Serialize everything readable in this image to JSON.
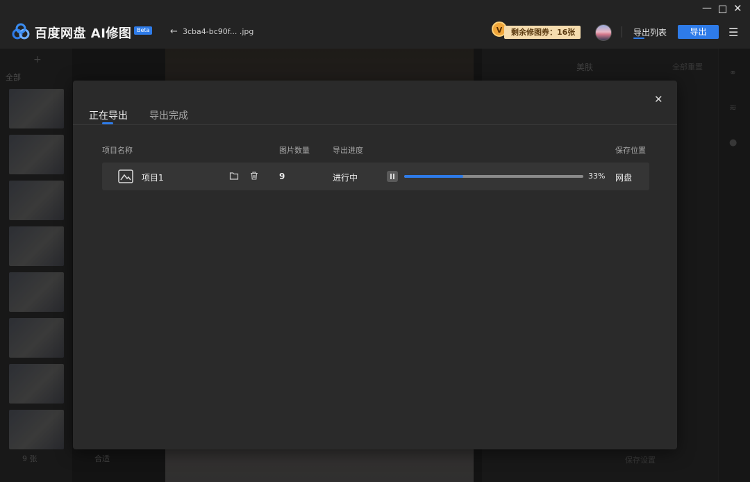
{
  "app": {
    "name": "百度网盘 AI修图",
    "beta_label": "Beta",
    "file_name": "3cba4-bc90f... .jpg"
  },
  "header": {
    "vip_letter": "V",
    "coupon_text": "剩余修图券：16张",
    "export_list_label": "导出列表",
    "export_button_label": "导出"
  },
  "background": {
    "filter_all": "全部",
    "image_count": "9 张",
    "fit_label": "合适",
    "panel_title": "美肤",
    "reset_all": "全部重置",
    "bottom_right": "保存设置"
  },
  "modal": {
    "tabs": [
      {
        "label": "正在导出",
        "active": true
      },
      {
        "label": "导出完成",
        "active": false
      }
    ],
    "columns": {
      "name": "项目名称",
      "count": "图片数量",
      "progress": "导出进度",
      "location": "保存位置"
    },
    "rows": [
      {
        "name": "项目1",
        "count": "9",
        "status": "进行中",
        "progress": 33,
        "progress_text": "33%",
        "location": "网盘"
      }
    ]
  },
  "colors": {
    "accent": "#2e7be8",
    "modal_bg": "#2a2a2a",
    "row_bg": "#353535",
    "coupon_bg": "#f5dcae"
  },
  "icons": {
    "logo": "baidu-netdisk-logo",
    "back": "arrow-left-icon",
    "menu": "hamburger-menu-icon",
    "close": "close-icon",
    "project": "image-icon",
    "open_folder": "folder-icon",
    "delete": "trash-icon",
    "pause": "pause-icon"
  }
}
